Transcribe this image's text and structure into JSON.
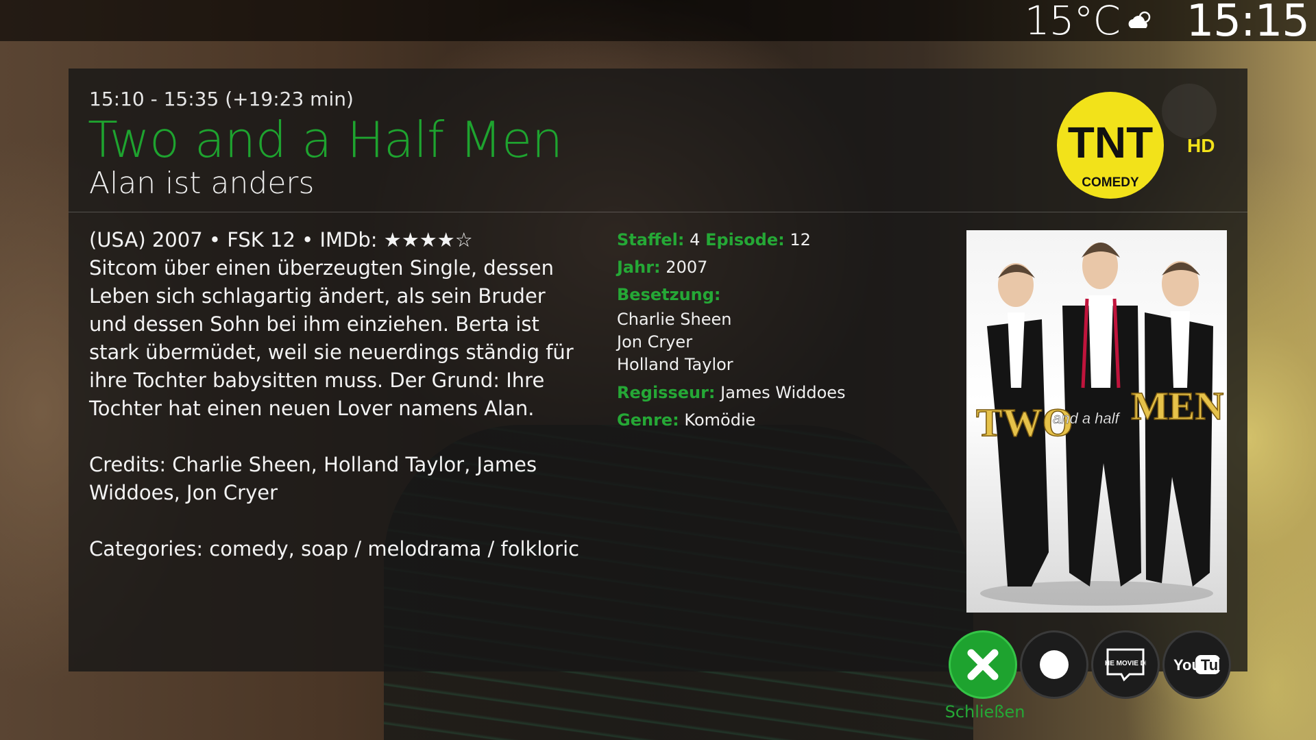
{
  "topbar": {
    "temperature": "15°C",
    "weather_icon": "partly-cloudy-icon",
    "time": "15:15"
  },
  "header": {
    "time_range": "15:10 - 15:35 (+19:23 min)",
    "title": "Two and a Half Men",
    "episode_title": "Alan ist anders",
    "channel_logo": "TNT Comedy HD"
  },
  "content": {
    "meta": "(USA) 2007 • FSK 12 • IMDb: ★★★★☆",
    "plot": "Sitcom über einen überzeugten Single, dessen Leben sich schlagartig ändert, als sein Bruder und dessen Sohn bei ihm einziehen. Berta ist stark übermüdet, weil sie neuerdings ständig für ihre Tochter babysitten muss. Der Grund: Ihre Tochter hat einen neuen Lover namens Alan.",
    "credits": "Credits: Charlie Sheen, Holland Taylor, James Widdoes, Jon Cryer",
    "categories": "Categories: comedy, soap / melodrama / folkloric"
  },
  "details": {
    "season_label": "Staffel:",
    "season": "4",
    "episode_label": "Episode:",
    "episode": "12",
    "year_label": "Jahr:",
    "year": "2007",
    "cast_label": "Besetzung:",
    "cast": [
      "Charlie Sheen",
      "Jon Cryer",
      "Holland Taylor"
    ],
    "director_label": "Regisseur:",
    "director": "James Widdoes",
    "genre_label": "Genre:",
    "genre": "Komödie"
  },
  "poster": {
    "text_left": "TWO",
    "text_mid": "and a half",
    "text_right": "MEN"
  },
  "buttons": [
    {
      "name": "close",
      "label": "Schließen",
      "icon": "close-icon"
    },
    {
      "name": "record",
      "icon": "record-icon"
    },
    {
      "name": "tmdb",
      "icon": "tmdb-icon",
      "icon_text": "THE MOVIE DB"
    },
    {
      "name": "youtube",
      "icon": "youtube-icon",
      "icon_text": "YouTube"
    }
  ],
  "colors": {
    "accent_green": "#1ea32f",
    "logo_yellow": "#f2e21a"
  }
}
